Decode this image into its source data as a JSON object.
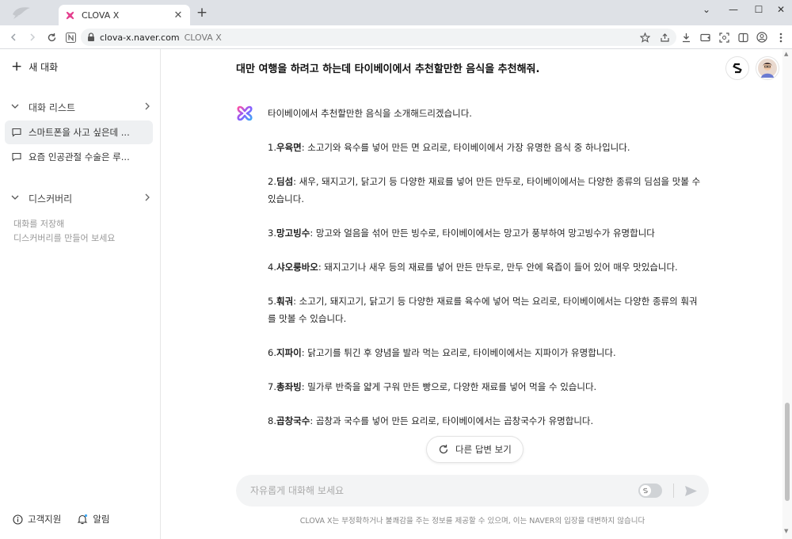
{
  "browser": {
    "tab_title": "CLOVA X",
    "tab_close": "✕",
    "new_tab": "+",
    "url_host": "clova-x.naver.com",
    "url_title": "CLOVA X",
    "window_controls": {
      "chevron": "⌄",
      "minimize": "—",
      "maximize": "☐",
      "close": "✕"
    }
  },
  "sidebar": {
    "new_chat": "새 대화",
    "chat_list_header": "대화 리스트",
    "chats": [
      {
        "label": "스마트폰을 사고 싶은데 ..."
      },
      {
        "label": "요즘 인공관절 수술은 루..."
      }
    ],
    "discovery_header": "디스커버리",
    "discovery_empty_1": "대화를 저장해",
    "discovery_empty_2": "디스커버리를 만들어 보세요",
    "footer_support": "고객지원",
    "footer_notifications": "알림"
  },
  "conversation": {
    "title": "대만 여행을 하려고 하는데 타이베이에서 추천할만한 음식을 추천해줘.",
    "intro": "타이베이에서 추천할만한 음식을 소개해드리겠습니다.",
    "items": [
      {
        "num": "1.",
        "name": "우육면",
        "desc": ": 소고기와 육수를 넣어 만든 면 요리로, 타이베이에서 가장 유명한 음식 중 하나입니다."
      },
      {
        "num": "2.",
        "name": "딤섬",
        "desc": ": 새우, 돼지고기, 닭고기 등 다양한 재료를 넣어 만든 만두로, 타이베이에서는 다양한 종류의 딤섬을 맛볼 수 있습니다."
      },
      {
        "num": "3.",
        "name": "망고빙수",
        "desc": ": 망고와 얼음을 섞어 만든 빙수로, 타이베이에서는 망고가 풍부하여 망고빙수가 유명합니다"
      },
      {
        "num": "4.",
        "name": "샤오룽바오",
        "desc": ": 돼지고기나 새우 등의 재료를 넣어 만든 만두로, 만두 안에 육즙이 들어 있어 매우 맛있습니다."
      },
      {
        "num": "5.",
        "name": "훠궈",
        "desc": ": 소고기, 돼지고기, 닭고기 등 다양한 재료를 육수에 넣어 먹는 요리로, 타이베이에서는 다양한 종류의 훠궈를 맛볼 수 있습니다."
      },
      {
        "num": "6.",
        "name": "지파이",
        "desc": ": 닭고기를 튀긴 후 양념을 발라 먹는 요리로, 타이베이에서는 지파이가 유명합니다."
      },
      {
        "num": "7.",
        "name": "총좌빙",
        "desc": ": 밀가루 반죽을 얇게 구워 만든 빵으로, 다양한 재료를 넣어 먹을 수 있습니다."
      },
      {
        "num": "8.",
        "name": "곱창국수",
        "desc": ": 곱창과 국수를 넣어 만든 요리로, 타이베이에서는 곱창국수가 유명합니다."
      }
    ],
    "regenerate": "다른 답변 보기"
  },
  "input": {
    "placeholder": "자유롭게 대화해 보세요",
    "disclaimer": "CLOVA X는 부정확하거나 불쾌감을 주는 정보를 제공할 수 있으며, 이는 NAVER의 입장을 대변하지 않습니다"
  },
  "colors": {
    "brand_pink": "#ff4fa3",
    "brand_purple": "#8a5cff",
    "brand_blue": "#3fa9f5"
  }
}
